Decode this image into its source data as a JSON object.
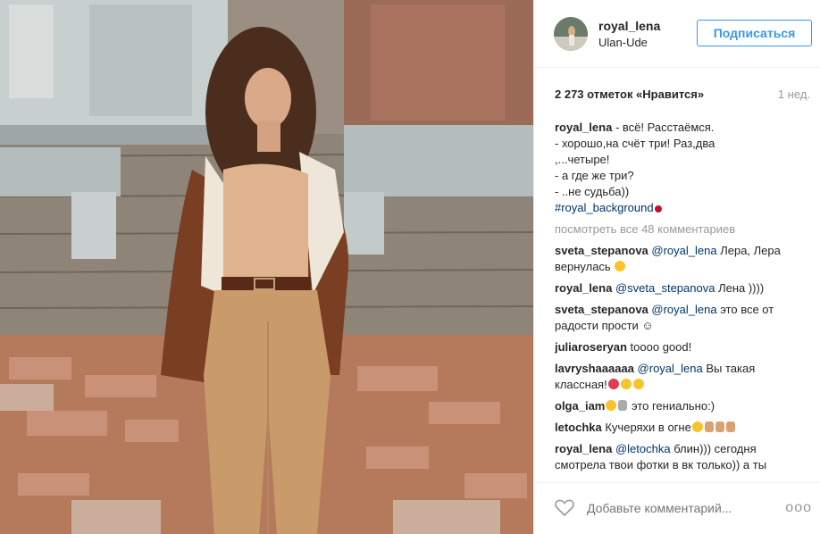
{
  "post": {
    "username": "royal_lena",
    "location": "Ulan-Ude",
    "follow_label": "Подписаться",
    "likes": "2 273 отметок «Нравится»",
    "time_ago": "1 нед."
  },
  "caption": {
    "user": "royal_lena",
    "lines": [
      " - всё! Расстаёмся.",
      "- хорошо,на счёт три! Раз,два",
      ",...четыре!",
      "- а где же три?",
      "- ..не судьба))"
    ],
    "hashtag": "#royal_background"
  },
  "view_all": "посмотреть все 48 комментариев",
  "comments": [
    {
      "user": "sveta_stepanova",
      "mention": "@royal_lena",
      "text": " Лера, Лера вернулась "
    },
    {
      "user": "royal_lena",
      "mention": "@sveta_stepanova",
      "text": " Лена ))))"
    },
    {
      "user": "sveta_stepanova",
      "mention": "@royal_lena",
      "text": " это все от радости  прости ☺"
    },
    {
      "user": "juliaroseryan",
      "mention": "",
      "text": " toooo good!"
    },
    {
      "user": "lavryshaaaaaa",
      "mention": "@royal_lena",
      "text": " Вы такая классная!"
    },
    {
      "user": "olga_iam",
      "mention": "",
      "text": "  это гениально:)"
    },
    {
      "user": "letochka",
      "mention": "",
      "text": " Кучеряхи в огне"
    },
    {
      "user": "royal_lena",
      "mention": "@letochka",
      "text": " блин))) сегодня смотрела твои фотки в вк только)) а ты"
    }
  ],
  "footer": {
    "add_comment_placeholder": "Добавьте комментарий...",
    "more_label": "ooo"
  },
  "icons": {
    "heart": "heart-icon",
    "more": "more-options-icon"
  }
}
